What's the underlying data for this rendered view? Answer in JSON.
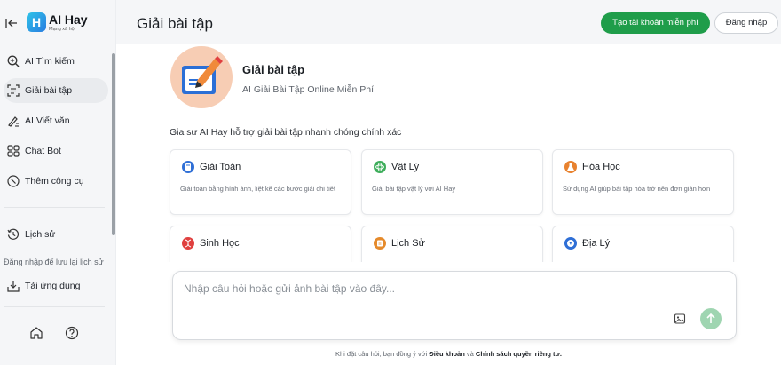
{
  "sidebar": {
    "logo_mark": "H",
    "logo_name": "AI Hay",
    "logo_tagline": "Mạng xã hội",
    "items": [
      {
        "label": "AI Tìm kiếm",
        "icon": "search-plus-icon"
      },
      {
        "label": "Giải bài tập",
        "icon": "scan-text-icon",
        "active": true
      },
      {
        "label": "AI Viết văn",
        "icon": "pen-lines-icon"
      },
      {
        "label": "Chat Bot",
        "icon": "chat-grid-icon"
      },
      {
        "label": "Thêm công cụ",
        "icon": "compass-icon"
      }
    ],
    "history_label": "Lịch sử",
    "login_hint": "Đăng nhập để lưu lại lịch sử",
    "download_label": "Tải ứng dụng"
  },
  "header": {
    "title": "Giải bài tập",
    "signup_label": "Tạo tài khoản miễn phí",
    "login_label": "Đăng nhập"
  },
  "hero": {
    "title": "Giải bài tập",
    "subtitle": "AI Giải Bài Tập Online Miễn Phí"
  },
  "intro": "Gia sư AI Hay hỗ trợ giải bài tập nhanh chóng chính xác",
  "cards": [
    {
      "title": "Giải Toán",
      "desc": "Giải toán bằng hình ảnh, liệt kê các bước giải chi tiết",
      "color": "#2f6fd6"
    },
    {
      "title": "Vật Lý",
      "desc": "Giải bài tập vật lý với AI Hay",
      "color": "#3fae5c"
    },
    {
      "title": "Hóa Học",
      "desc": "Sử dụng AI giúp bài tập hóa trở nên đơn giản hơn",
      "color": "#e8822f"
    },
    {
      "title": "Sinh Học",
      "desc": "",
      "color": "#e0403f"
    },
    {
      "title": "Lịch Sử",
      "desc": "",
      "color": "#e58a2b"
    },
    {
      "title": "Địa Lý",
      "desc": "",
      "color": "#2f6fd6"
    }
  ],
  "chat": {
    "placeholder": "Nhập câu hỏi hoặc gửi ảnh bài tập vào đây..."
  },
  "footer": {
    "prefix": "Khi đặt câu hỏi, bạn đồng ý với ",
    "terms": "Điều khoản",
    "and": " và ",
    "privacy": "Chính sách quyền riêng tư."
  },
  "colors": {
    "accent": "#1f9d4a",
    "hero_bg": "#f7cdb4",
    "send_button": "#9fd5b1"
  }
}
